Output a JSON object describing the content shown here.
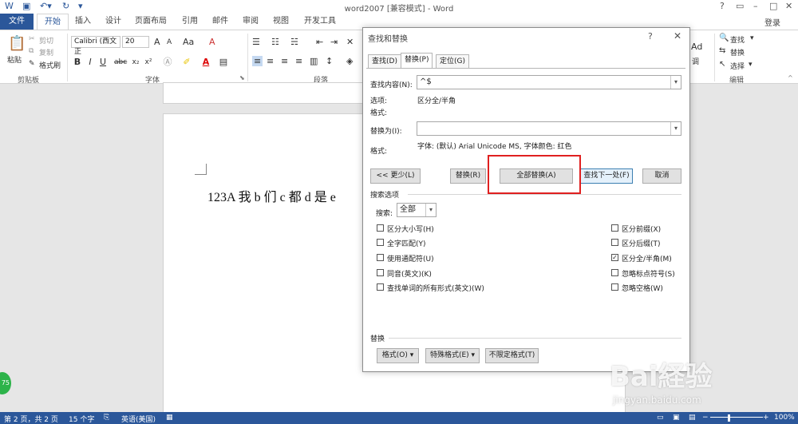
{
  "window": {
    "title": "word2007 [兼容模式] - Word",
    "help": "?",
    "login": "登录"
  },
  "ribbon_tabs": [
    "文件",
    "开始",
    "插入",
    "设计",
    "页面布局",
    "引用",
    "邮件",
    "审阅",
    "视图",
    "开发工具"
  ],
  "clipboard": {
    "paste": "粘贴",
    "cut": "剪切",
    "copy": "复制",
    "format_painter": "格式刷",
    "group": "剪贴板"
  },
  "font": {
    "name": "Calibri (西文正",
    "size": "20",
    "group": "字体",
    "grow": "A",
    "shrink": "A",
    "case": "Aa",
    "clear": "A",
    "bold": "B",
    "italic": "I",
    "underline": "U",
    "strike": "abc",
    "sub": "x₂",
    "sup": "x²"
  },
  "paragraph": {
    "group": "段落"
  },
  "styles": {
    "sample": "Ad",
    "adjust": "调"
  },
  "editing": {
    "find": "查找",
    "replace": "替换",
    "select": "选择",
    "group": "编辑"
  },
  "document": {
    "text": "123A 我 b 们 c 都 d 是 e"
  },
  "dialog": {
    "title": "查找和替换",
    "help": "?",
    "tabs": [
      "查找(D)",
      "替换(P)",
      "定位(G)"
    ],
    "find_label": "查找内容(N):",
    "find_value": "^$",
    "options_label": "选项:",
    "options_value": "区分全/半角",
    "format_label": "格式:",
    "replace_label": "替换为(I):",
    "replace_value": "",
    "replace_format_label": "格式:",
    "replace_format_value": "字体: (默认) Arial Unicode MS, 字体颜色: 红色",
    "buttons": {
      "less": "<< 更少(L)",
      "replace": "替换(R)",
      "replace_all": "全部替换(A)",
      "find_next": "查找下一处(F)",
      "cancel": "取消"
    },
    "search_options_label": "搜索选项",
    "search_label": "搜索:",
    "search_value": "全部",
    "left_options": [
      {
        "label": "区分大小写(H)",
        "checked": false
      },
      {
        "label": "全字匹配(Y)",
        "checked": false
      },
      {
        "label": "使用通配符(U)",
        "checked": false
      },
      {
        "label": "同音(英文)(K)",
        "checked": false
      },
      {
        "label": "查找单词的所有形式(英文)(W)",
        "checked": false
      }
    ],
    "right_options": [
      {
        "label": "区分前缀(X)",
        "checked": false
      },
      {
        "label": "区分后缀(T)",
        "checked": false
      },
      {
        "label": "区分全/半角(M)",
        "checked": true
      },
      {
        "label": "忽略标点符号(S)",
        "checked": false
      },
      {
        "label": "忽略空格(W)",
        "checked": false
      }
    ],
    "replace_section_label": "替换",
    "bottom_buttons": {
      "format": "格式(O) ▾",
      "special": "特殊格式(E) ▾",
      "no_format": "不限定格式(T)"
    }
  },
  "statusbar": {
    "page": "第 2 页，共 2 页",
    "words": "15 个字",
    "language": "英语(美国)",
    "zoom": "100%"
  },
  "watermark": {
    "brand": "Bai経验",
    "url": "jingyan.baidu.com"
  },
  "badge": "75",
  "colors": {
    "accent": "#2b579a",
    "highlight_box": "#e02020"
  }
}
